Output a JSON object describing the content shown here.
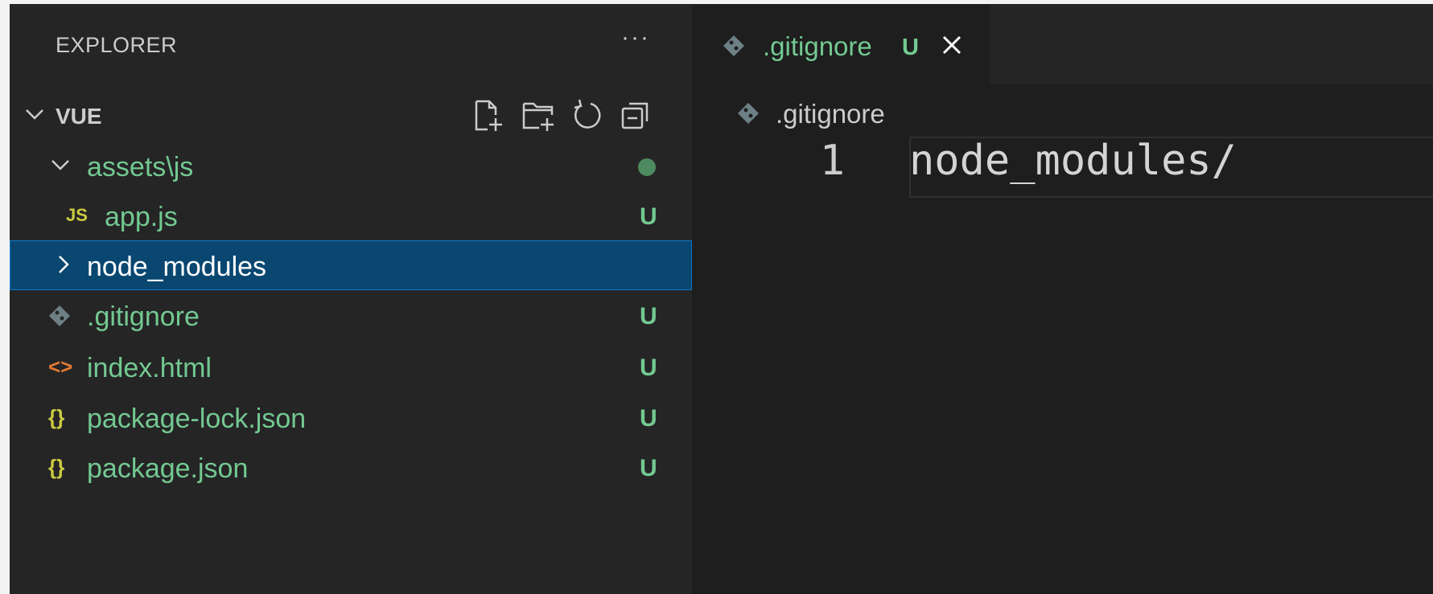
{
  "explorer": {
    "title": "EXPLORER",
    "more_actions": "···",
    "section": {
      "title": "VUE",
      "actions": [
        "new-file-icon",
        "new-folder-icon",
        "refresh-icon",
        "collapse-all-icon"
      ]
    },
    "tree": [
      {
        "label": "assets\\js",
        "type": "folder",
        "expanded": true,
        "badge": "",
        "status": "modified-dot"
      },
      {
        "label": "app.js",
        "type": "js",
        "icon_text": "JS",
        "badge": "U"
      },
      {
        "label": "node_modules",
        "type": "folder",
        "expanded": false,
        "badge": "",
        "selected": true
      },
      {
        "label": ".gitignore",
        "type": "git",
        "badge": "U"
      },
      {
        "label": "index.html",
        "type": "html",
        "icon_text": "<>",
        "badge": "U"
      },
      {
        "label": "package-lock.json",
        "type": "json",
        "icon_text": "{}",
        "badge": "U"
      },
      {
        "label": "package.json",
        "type": "json",
        "icon_text": "{}",
        "badge": "U"
      }
    ]
  },
  "editor": {
    "tab": {
      "label": ".gitignore",
      "badge": "U",
      "close_icon": "close-icon"
    },
    "breadcrumb": {
      "label": ".gitignore"
    },
    "lines": [
      {
        "number": "1",
        "text": "node_modules/"
      }
    ]
  },
  "colors": {
    "untracked": "#73c991",
    "selection": "#094771",
    "js_icon": "#cbcb41",
    "html_icon": "#e37933",
    "json_icon": "#cbcb41",
    "git_icon": "#6d8086"
  }
}
